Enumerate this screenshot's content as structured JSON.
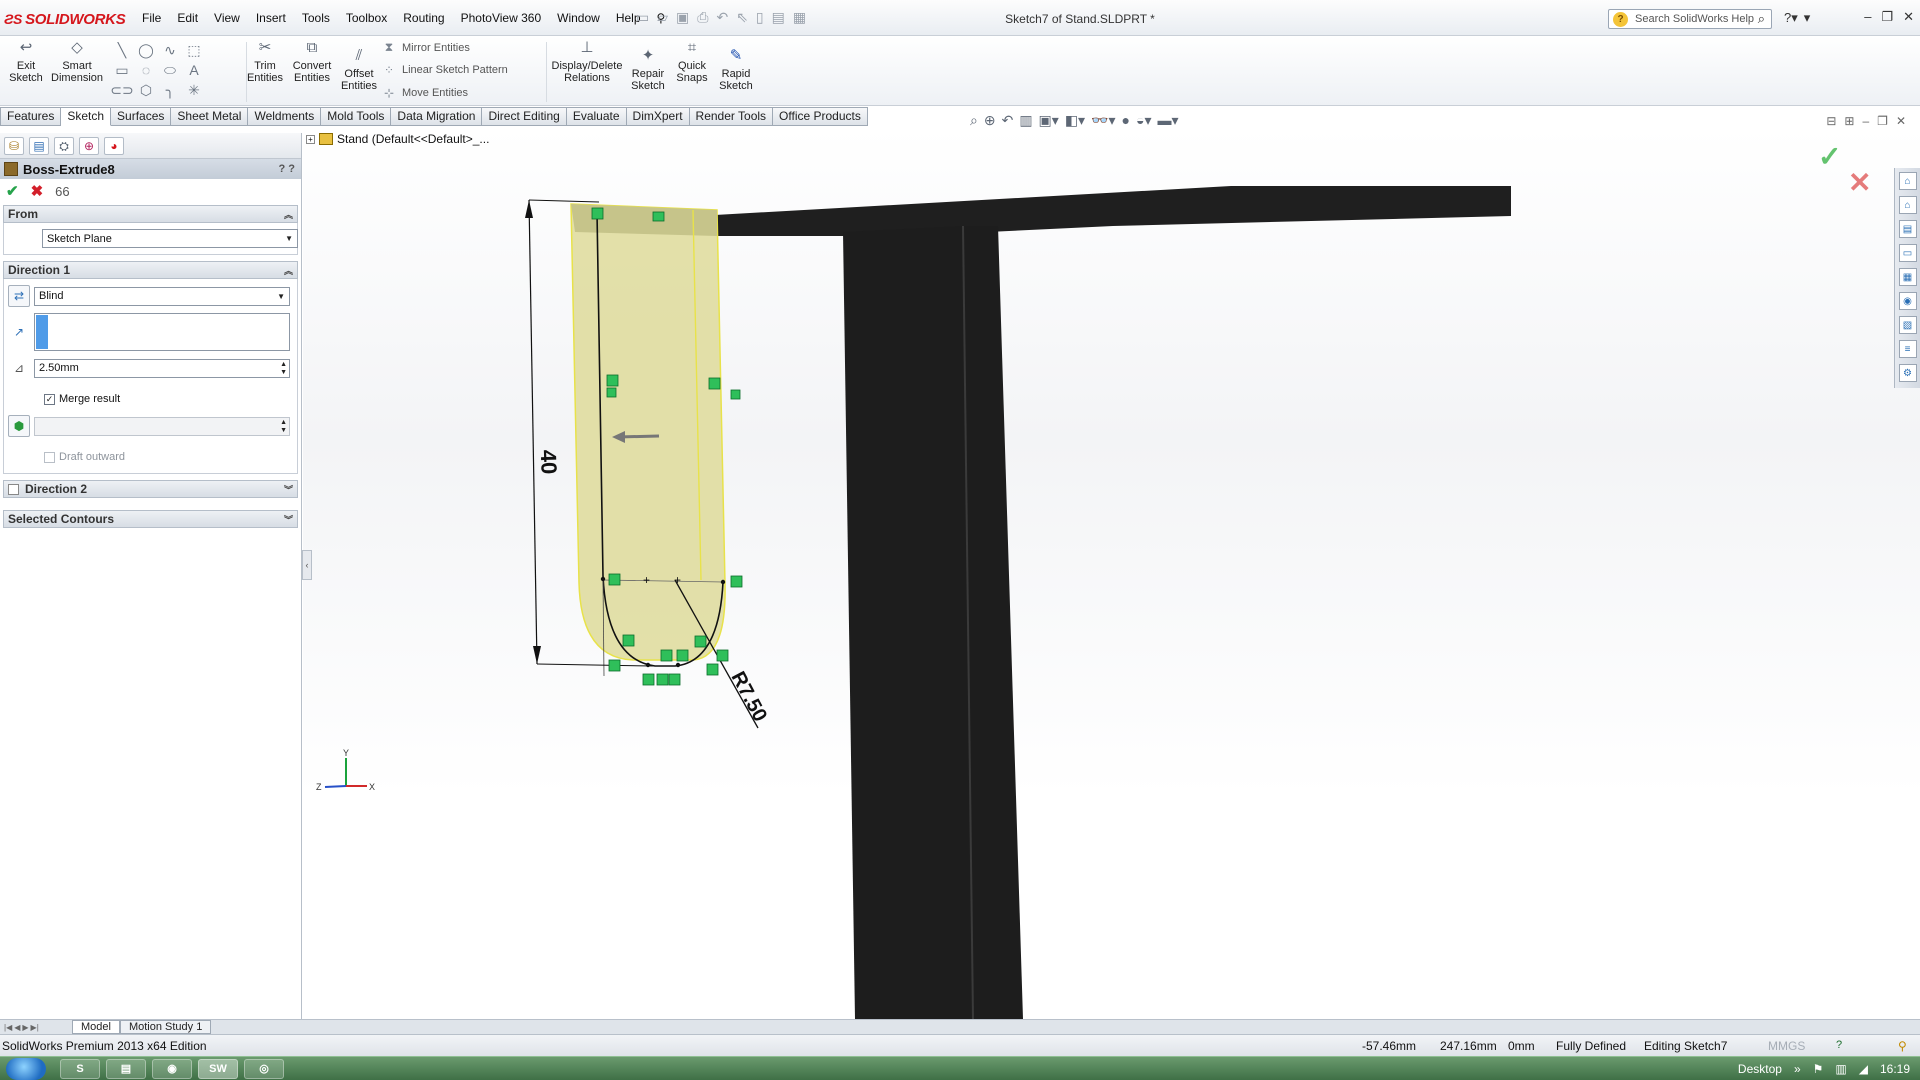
{
  "app": {
    "logo_text": "SOLIDWORKS",
    "document_title": "Sketch7 of Stand.SLDPRT *",
    "search_placeholder": "Search SolidWorks Help"
  },
  "menu": [
    "File",
    "Edit",
    "View",
    "Insert",
    "Tools",
    "Toolbox",
    "Routing",
    "PhotoView 360",
    "Window",
    "Help"
  ],
  "command_manager": {
    "exit_sketch": "Exit Sketch",
    "smart_dimension": "Smart Dimension",
    "trim_entities": "Trim Entities",
    "convert_entities": "Convert Entities",
    "offset_entities": "Offset Entities",
    "mirror_entities": "Mirror Entities",
    "linear_sketch_pattern": "Linear Sketch Pattern",
    "move_entities": "Move Entities",
    "display_delete_relations": "Display/Delete Relations",
    "repair_sketch": "Repair Sketch",
    "quick_snaps": "Quick Snaps",
    "rapid_sketch": "Rapid Sketch"
  },
  "tabs": [
    {
      "label": "Features",
      "active": false
    },
    {
      "label": "Sketch",
      "active": true
    },
    {
      "label": "Surfaces",
      "active": false
    },
    {
      "label": "Sheet Metal",
      "active": false
    },
    {
      "label": "Weldments",
      "active": false
    },
    {
      "label": "Mold Tools",
      "active": false
    },
    {
      "label": "Data Migration",
      "active": false
    },
    {
      "label": "Direct Editing",
      "active": false
    },
    {
      "label": "Evaluate",
      "active": false
    },
    {
      "label": "DimXpert",
      "active": false
    },
    {
      "label": "Render Tools",
      "active": false
    },
    {
      "label": "Office Products",
      "active": false
    }
  ],
  "property_manager": {
    "title": "Boss-Extrude8",
    "help": "? ?",
    "from": {
      "header": "From",
      "value": "Sketch Plane"
    },
    "direction1": {
      "header": "Direction 1",
      "end_condition": "Blind",
      "depth": "2.50mm",
      "merge_result_label": "Merge result",
      "merge_result_checked": true,
      "draft_outward_label": "Draft outward",
      "draft_outward_checked": false
    },
    "direction2": {
      "header": "Direction 2"
    },
    "selected_contours": {
      "header": "Selected Contours"
    }
  },
  "feature_tree": {
    "root": "Stand  (Default<<Default>_..."
  },
  "sketch": {
    "dimension_height": "40",
    "dimension_radius": "R7.50"
  },
  "triad": {
    "x": "X",
    "y": "Y",
    "z": "Z"
  },
  "bottom_tabs": [
    {
      "label": "Model",
      "active": true
    },
    {
      "label": "Motion Study 1",
      "active": false
    }
  ],
  "status": {
    "edition": "SolidWorks Premium 2013 x64 Edition",
    "x_coord": "-57.46mm",
    "y_coord": "247.16mm",
    "z_coord": "0mm",
    "definition": "Fully Defined",
    "mode": "Editing Sketch7",
    "units": "MMGS"
  },
  "taskbar": {
    "desktop_label": "Desktop",
    "time": "16:19"
  },
  "colors": {
    "accent": "#d5161c",
    "solid_body": "#1f1f1f",
    "extrude_preview": "#dedb9a",
    "relation_badge": "#2fbf5a"
  }
}
